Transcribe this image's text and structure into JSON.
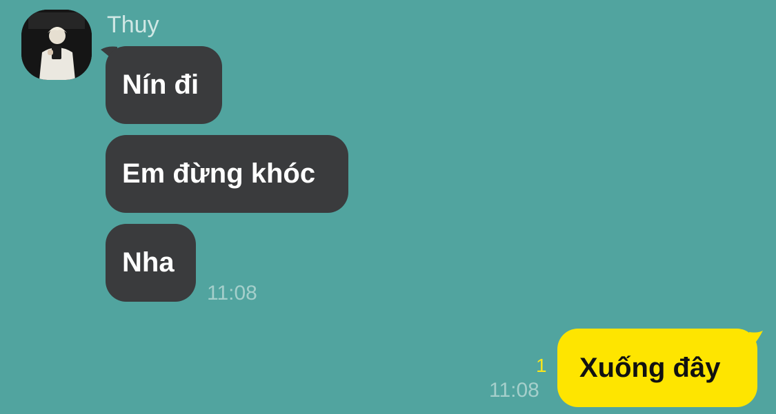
{
  "chat": {
    "sender_name": "Thuy",
    "incoming": [
      {
        "text": "Nín đi"
      },
      {
        "text": "Em đừng khóc"
      },
      {
        "text": "Nha"
      }
    ],
    "incoming_time": "11:08",
    "outgoing": {
      "text": "Xuống đây",
      "time": "11:08",
      "unread_count": "1"
    }
  },
  "colors": {
    "background": "#51a49f",
    "incoming_bubble": "#3a3b3d",
    "outgoing_bubble": "#fee500",
    "unread_count": "#f8e51c"
  }
}
